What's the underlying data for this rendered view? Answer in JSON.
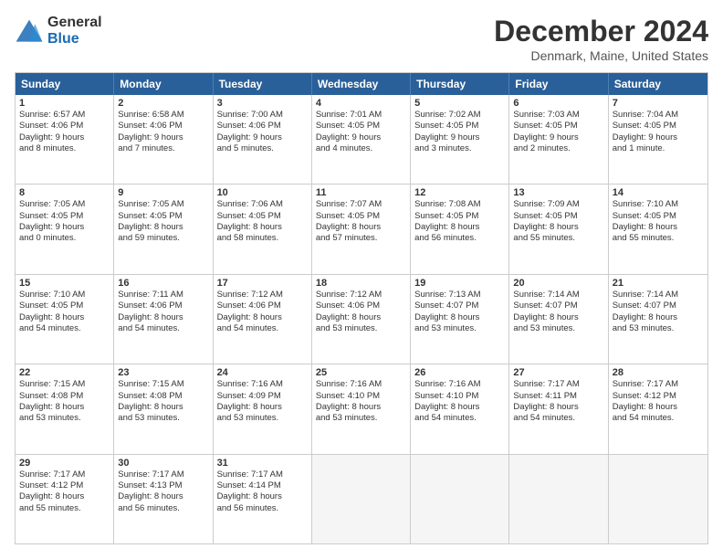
{
  "header": {
    "logo_general": "General",
    "logo_blue": "Blue",
    "month_title": "December 2024",
    "location": "Denmark, Maine, United States"
  },
  "days_of_week": [
    "Sunday",
    "Monday",
    "Tuesday",
    "Wednesday",
    "Thursday",
    "Friday",
    "Saturday"
  ],
  "weeks": [
    [
      {
        "day": "1",
        "sunrise": "6:57 AM",
        "sunset": "4:06 PM",
        "daylight": "9 hours and 8 minutes."
      },
      {
        "day": "2",
        "sunrise": "6:58 AM",
        "sunset": "4:06 PM",
        "daylight": "9 hours and 7 minutes."
      },
      {
        "day": "3",
        "sunrise": "7:00 AM",
        "sunset": "4:06 PM",
        "daylight": "9 hours and 5 minutes."
      },
      {
        "day": "4",
        "sunrise": "7:01 AM",
        "sunset": "4:05 PM",
        "daylight": "9 hours and 4 minutes."
      },
      {
        "day": "5",
        "sunrise": "7:02 AM",
        "sunset": "4:05 PM",
        "daylight": "9 hours and 3 minutes."
      },
      {
        "day": "6",
        "sunrise": "7:03 AM",
        "sunset": "4:05 PM",
        "daylight": "9 hours and 2 minutes."
      },
      {
        "day": "7",
        "sunrise": "7:04 AM",
        "sunset": "4:05 PM",
        "daylight": "9 hours and 1 minute."
      }
    ],
    [
      {
        "day": "8",
        "sunrise": "7:05 AM",
        "sunset": "4:05 PM",
        "daylight": "9 hours and 0 minutes."
      },
      {
        "day": "9",
        "sunrise": "7:05 AM",
        "sunset": "4:05 PM",
        "daylight": "8 hours and 59 minutes."
      },
      {
        "day": "10",
        "sunrise": "7:06 AM",
        "sunset": "4:05 PM",
        "daylight": "8 hours and 58 minutes."
      },
      {
        "day": "11",
        "sunrise": "7:07 AM",
        "sunset": "4:05 PM",
        "daylight": "8 hours and 57 minutes."
      },
      {
        "day": "12",
        "sunrise": "7:08 AM",
        "sunset": "4:05 PM",
        "daylight": "8 hours and 56 minutes."
      },
      {
        "day": "13",
        "sunrise": "7:09 AM",
        "sunset": "4:05 PM",
        "daylight": "8 hours and 55 minutes."
      },
      {
        "day": "14",
        "sunrise": "7:10 AM",
        "sunset": "4:05 PM",
        "daylight": "8 hours and 55 minutes."
      }
    ],
    [
      {
        "day": "15",
        "sunrise": "7:10 AM",
        "sunset": "4:05 PM",
        "daylight": "8 hours and 54 minutes."
      },
      {
        "day": "16",
        "sunrise": "7:11 AM",
        "sunset": "4:06 PM",
        "daylight": "8 hours and 54 minutes."
      },
      {
        "day": "17",
        "sunrise": "7:12 AM",
        "sunset": "4:06 PM",
        "daylight": "8 hours and 54 minutes."
      },
      {
        "day": "18",
        "sunrise": "7:12 AM",
        "sunset": "4:06 PM",
        "daylight": "8 hours and 53 minutes."
      },
      {
        "day": "19",
        "sunrise": "7:13 AM",
        "sunset": "4:07 PM",
        "daylight": "8 hours and 53 minutes."
      },
      {
        "day": "20",
        "sunrise": "7:14 AM",
        "sunset": "4:07 PM",
        "daylight": "8 hours and 53 minutes."
      },
      {
        "day": "21",
        "sunrise": "7:14 AM",
        "sunset": "4:07 PM",
        "daylight": "8 hours and 53 minutes."
      }
    ],
    [
      {
        "day": "22",
        "sunrise": "7:15 AM",
        "sunset": "4:08 PM",
        "daylight": "8 hours and 53 minutes."
      },
      {
        "day": "23",
        "sunrise": "7:15 AM",
        "sunset": "4:08 PM",
        "daylight": "8 hours and 53 minutes."
      },
      {
        "day": "24",
        "sunrise": "7:16 AM",
        "sunset": "4:09 PM",
        "daylight": "8 hours and 53 minutes."
      },
      {
        "day": "25",
        "sunrise": "7:16 AM",
        "sunset": "4:10 PM",
        "daylight": "8 hours and 53 minutes."
      },
      {
        "day": "26",
        "sunrise": "7:16 AM",
        "sunset": "4:10 PM",
        "daylight": "8 hours and 54 minutes."
      },
      {
        "day": "27",
        "sunrise": "7:17 AM",
        "sunset": "4:11 PM",
        "daylight": "8 hours and 54 minutes."
      },
      {
        "day": "28",
        "sunrise": "7:17 AM",
        "sunset": "4:12 PM",
        "daylight": "8 hours and 54 minutes."
      }
    ],
    [
      {
        "day": "29",
        "sunrise": "7:17 AM",
        "sunset": "4:12 PM",
        "daylight": "8 hours and 55 minutes."
      },
      {
        "day": "30",
        "sunrise": "7:17 AM",
        "sunset": "4:13 PM",
        "daylight": "8 hours and 56 minutes."
      },
      {
        "day": "31",
        "sunrise": "7:17 AM",
        "sunset": "4:14 PM",
        "daylight": "8 hours and 56 minutes."
      },
      null,
      null,
      null,
      null
    ]
  ]
}
